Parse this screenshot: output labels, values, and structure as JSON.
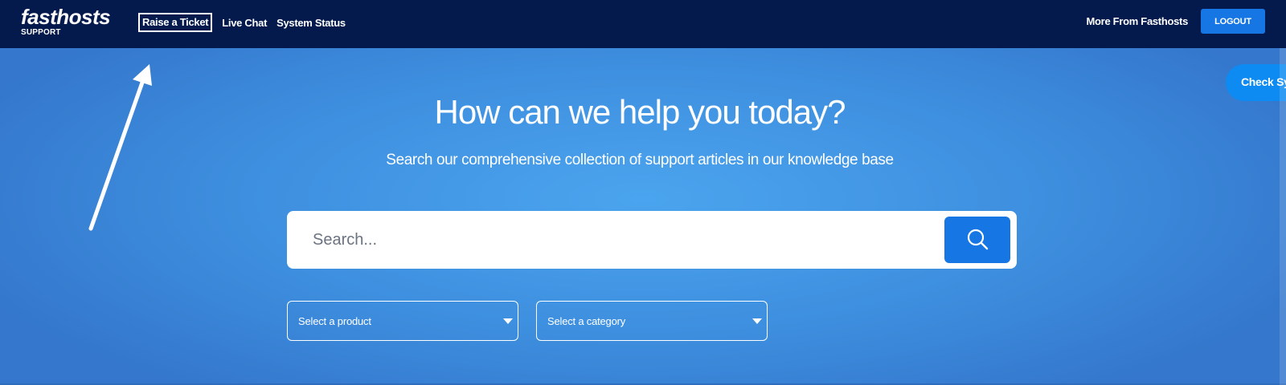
{
  "header": {
    "brand_name": "fasthosts",
    "brand_sub": "SUPPORT",
    "nav": [
      {
        "label": "Raise a Ticket",
        "highlighted": true
      },
      {
        "label": "Live Chat"
      },
      {
        "label": "System Status"
      }
    ],
    "more_link": "More From Fasthosts",
    "logout_label": "LOGOUT",
    "background_color": "#041a4d",
    "logout_color": "#1676e4"
  },
  "hero": {
    "title": "How can we help you today?",
    "subtitle": "Search our comprehensive collection of support articles in our knowledge base",
    "search": {
      "placeholder": "Search...",
      "value": "",
      "button_icon": "search-icon"
    },
    "selects": {
      "product": "Select a product",
      "category": "Select a category"
    },
    "check_status_label": "Check System Status",
    "gradient_center": "#4ba4ee",
    "gradient_edge": "#3477cc"
  },
  "annotation": {
    "type": "arrow",
    "color": "#ffffff",
    "points_to": "Raise a Ticket"
  }
}
